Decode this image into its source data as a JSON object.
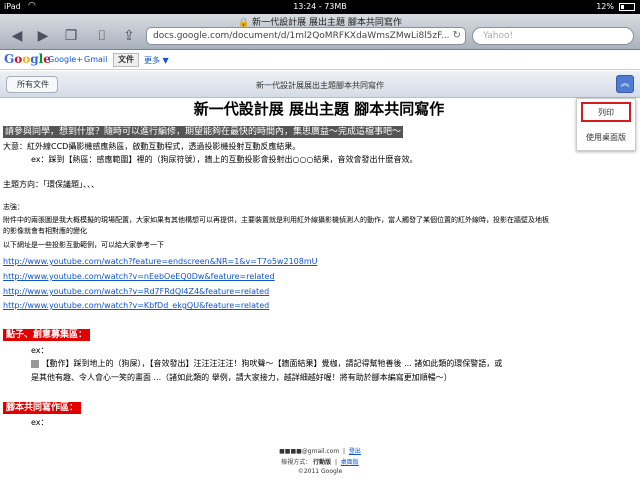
{
  "status_bar": {
    "device": "iPad",
    "time": "13:24 - 73MB",
    "battery": "12%"
  },
  "safari": {
    "page_title": "新一代設計展 展出主題 腳本共同寫作",
    "url": "docs.google.com/document/d/1ml2QoMRFKXdaWmsZMwLi8l5zF...",
    "search_placeholder": "Yahoo!"
  },
  "gbar": {
    "logo": "Google",
    "plus": "Google+",
    "gmail": "Gmail",
    "docs": "文件",
    "more": "更多 ▼"
  },
  "docbar": {
    "all_files": "所有文件",
    "title": "新一代設計展展出主題腳本共同寫作"
  },
  "popup": {
    "print": "列印",
    "desktop": "使用桌面版"
  },
  "doc": {
    "heading": "新一代設計展 展出主題 腳本共同寫作",
    "intro": "請參與同學，想到什麼？隨時可以進行編修，期望能夠在最快的時間內，集思廣益～完成這檔事吧～",
    "purpose": "大意：紅外線CCD攝影機感應熱區，啟動互動程式，透過投影機投射互動反應結果。",
    "example1": "ex：踩到【熱區：感應範圍】裡的（狗尿符號），牆上的互動投影會投射出○○○結果，音效會發出什麼音效。",
    "theme": "主題方向：「環保議題」、、、",
    "note_label": "志強：",
    "note_body": "附件中的兩張圖是我大概模擬的現場配置，大家如果有其他構想可以再提供，主要裝置就是利用紅外線攝影機偵測人的動作，當人觸發了某個位置的紅外線時，投影在牆壁及地板",
    "note_body2": "的影像就會有相對應的變化",
    "ref_label": "以下網址是一些投影互動範例，可以給大家參考一下",
    "links": [
      "http://www.youtube.com/watch?feature=endscreen&NR=1&v=T7o5w2108mU",
      "http://www.youtube.com/watch?v=nEebOeEQ0Dw&feature=related",
      "http://www.youtube.com/watch?v=Rd7FRdQl4Z4&feature=related",
      "http://www.youtube.com/watch?v=KbfDd_ekgQU&feature=related"
    ],
    "section1": "點子、創意募集區：",
    "ex_label": "ex：",
    "idea_line1": "【動作】踩到地上的（狗屎），【音效發出】汪汪汪汪汪！狗吠聲～【牆面結果】覺枷，請記得幫牠善後 ... 諸如此類的環保警語，或",
    "idea_line2": "是其他有趣、令人會心一笑的畫面 ...（諸如此類的 舉例，請大家接力，越詳細越好喔！將有助於腳本編寫更加順暢～）",
    "section2": "腳本共同寫作區：",
    "ex_label2": "ex："
  },
  "footer": {
    "email": "■■■■@gmail.com",
    "logout": "登出",
    "view_label": "檢視方式：",
    "mobile": "行動版",
    "desktop": "桌面版",
    "copyright": "©2011 Google"
  }
}
